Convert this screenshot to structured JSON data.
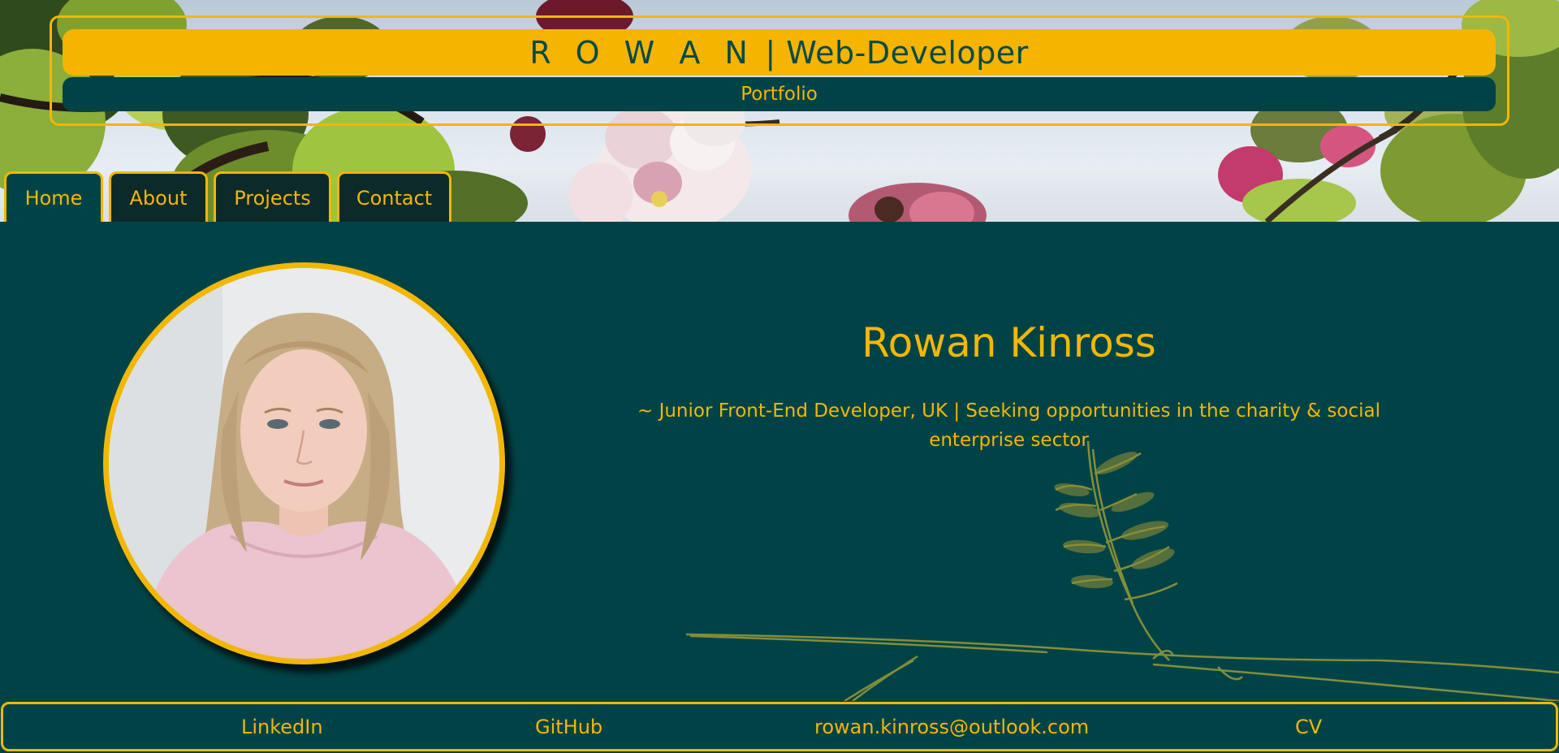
{
  "header": {
    "title_spaced": "R O W A N",
    "title_rest": " | Web-Developer",
    "subtitle": "Portfolio"
  },
  "nav": {
    "tabs": [
      {
        "label": "Home",
        "active": true
      },
      {
        "label": "About",
        "active": false
      },
      {
        "label": "Projects",
        "active": false
      },
      {
        "label": "Contact",
        "active": false
      }
    ]
  },
  "profile": {
    "name": "Rowan Kinross",
    "tagline": "~ Junior Front-End Developer, UK | Seeking opportunities in the charity & social enterprise sector"
  },
  "footer": {
    "links": [
      "LinkedIn",
      "GitHub",
      "rowan.kinross@outlook.com",
      "CV"
    ]
  },
  "colors": {
    "accent": "#f2b705",
    "background": "#004346"
  }
}
